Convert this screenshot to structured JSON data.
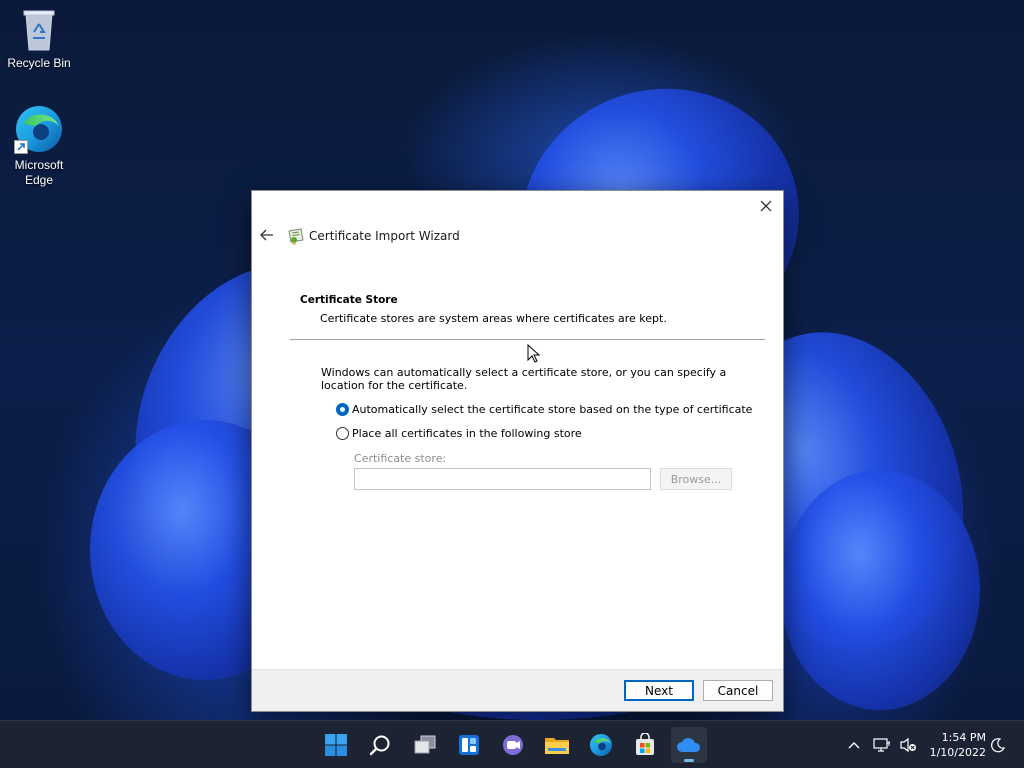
{
  "desktop": {
    "icons": [
      {
        "label": "Recycle Bin"
      },
      {
        "label": "Microsoft Edge"
      }
    ]
  },
  "dialog": {
    "title": "Certificate Import Wizard",
    "section_title": "Certificate Store",
    "section_description": "Certificate stores are system areas where certificates are kept.",
    "intro": "Windows can automatically select a certificate store, or you can specify a location for the certificate.",
    "options": [
      {
        "label": "Automatically select the certificate store based on the type of certificate",
        "selected": true
      },
      {
        "label": "Place all certificates in the following store",
        "selected": false
      }
    ],
    "store_label": "Certificate store:",
    "store_value": "",
    "browse_label": "Browse...",
    "next_label": "Next",
    "cancel_label": "Cancel"
  },
  "taskbar": {
    "apps": [
      "start-icon",
      "search-icon",
      "task-view-icon",
      "widgets-icon",
      "teams-chat-icon",
      "file-explorer-icon",
      "edge-icon",
      "store-icon",
      "onedrive-icon"
    ],
    "time": "1:54 PM",
    "date": "1/10/2022"
  },
  "colors": {
    "accent": "#0067c0",
    "taskbar": "#1c2434"
  }
}
